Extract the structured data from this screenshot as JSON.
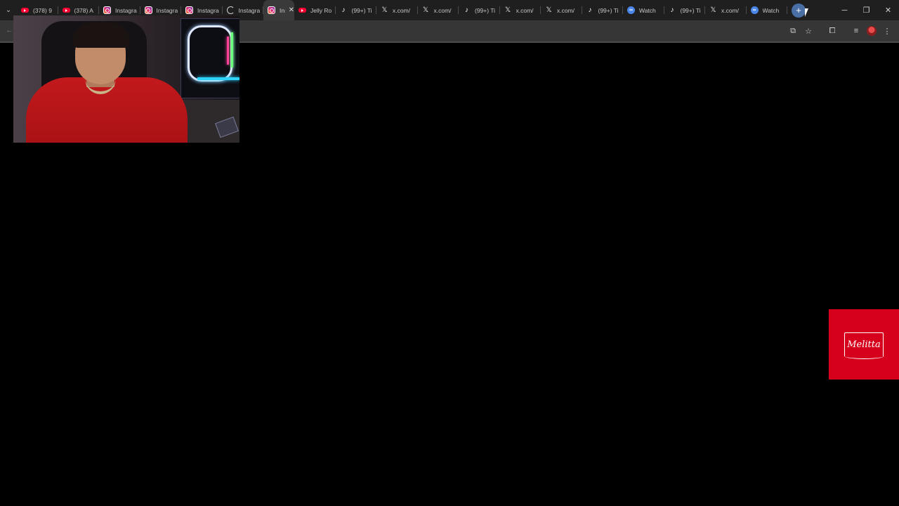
{
  "tabs": [
    {
      "icon": "youtube-icon",
      "title": "(378) 9"
    },
    {
      "icon": "youtube-icon",
      "title": "(378) A"
    },
    {
      "icon": "instagram-icon",
      "title": "Instagra"
    },
    {
      "icon": "instagram-icon",
      "title": "Instagra"
    },
    {
      "icon": "instagram-icon",
      "title": "Instagra"
    },
    {
      "icon": "loading-icon",
      "title": "Instagra"
    },
    {
      "icon": "instagram-icon",
      "title": "Ins",
      "active": true
    },
    {
      "icon": "youtube-icon",
      "title": "Jelly Ro"
    },
    {
      "icon": "tiktok-icon",
      "title": "(99+) Ti"
    },
    {
      "icon": "x-icon",
      "title": "x.com/"
    },
    {
      "icon": "x-icon",
      "title": "x.com/"
    },
    {
      "icon": "tiktok-icon",
      "title": "(99+) Ti"
    },
    {
      "icon": "x-icon",
      "title": "x.com/"
    },
    {
      "icon": "x-icon",
      "title": "x.com/"
    },
    {
      "icon": "tiktok-icon",
      "title": "(99+) Ti"
    },
    {
      "icon": "watch-icon",
      "title": "Watch"
    },
    {
      "icon": "tiktok-icon",
      "title": "(99+) Ti"
    },
    {
      "icon": "x-icon",
      "title": "x.com/"
    },
    {
      "icon": "watch-icon",
      "title": "Watch"
    }
  ],
  "glyphs": {
    "tab_search": "⌄",
    "tab_close": "✕",
    "new_tab": "+",
    "minimize": "─",
    "restore": "❐",
    "close": "✕",
    "back": "←",
    "install": "⧉",
    "bookmark": "☆",
    "extensions": "⧠",
    "media": "≡",
    "menu": "⋮",
    "tiktok": "♪",
    "x": "𝕏",
    "watch": "∞"
  },
  "sponsor": {
    "text": "Melitta",
    "color": "#d6001c"
  }
}
